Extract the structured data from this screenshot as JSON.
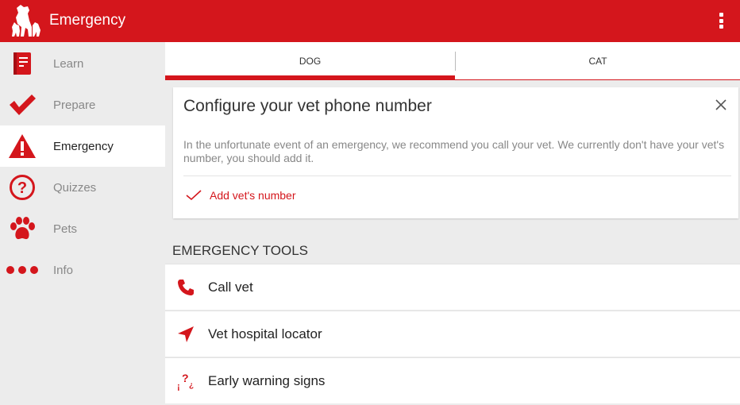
{
  "app": {
    "title": "Emergency",
    "brand_color": "#d4161c"
  },
  "sidebar": {
    "items": [
      {
        "label": "Learn",
        "icon": "book-icon"
      },
      {
        "label": "Prepare",
        "icon": "check-icon"
      },
      {
        "label": "Emergency",
        "icon": "warning-icon",
        "active": true
      },
      {
        "label": "Quizzes",
        "icon": "question-circle-icon"
      },
      {
        "label": "Pets",
        "icon": "paw-icon"
      },
      {
        "label": "Info",
        "icon": "dots-icon"
      }
    ]
  },
  "tabs": [
    {
      "label": "DOG",
      "selected": true
    },
    {
      "label": "CAT",
      "selected": false
    }
  ],
  "vet_card": {
    "title": "Configure your vet phone number",
    "body": "In the unfortunate event of an emergency, we recommend you call your vet. We currently don't have your vet's number, you should add it.",
    "action_label": "Add vet's number"
  },
  "tools": {
    "heading": "EMERGENCY TOOLS",
    "items": [
      {
        "label": "Call vet",
        "icon": "phone-icon"
      },
      {
        "label": "Vet hospital locator",
        "icon": "location-arrow-icon"
      },
      {
        "label": "Early warning signs",
        "icon": "warning-signs-icon"
      }
    ]
  }
}
